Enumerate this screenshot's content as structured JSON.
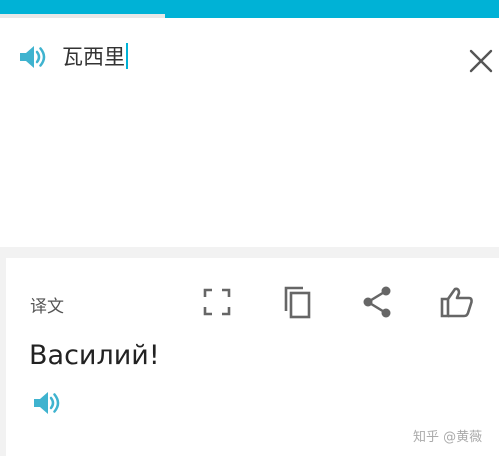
{
  "colors": {
    "accent": "#00b2d6",
    "text": "#222222",
    "muted": "#555555",
    "icon": "#666666"
  },
  "progress": 0.33,
  "input": {
    "speaker_icon": "speaker-icon",
    "text": "瓦西里",
    "clear_icon": "close-icon"
  },
  "result": {
    "label": "译文",
    "tools": [
      {
        "icon": "fullscreen-icon"
      },
      {
        "icon": "copy-icon"
      },
      {
        "icon": "share-icon"
      },
      {
        "icon": "thumbs-up-icon"
      }
    ],
    "text": "Василий!",
    "speaker_icon": "speaker-icon"
  },
  "watermark": "知乎 @黄薇"
}
